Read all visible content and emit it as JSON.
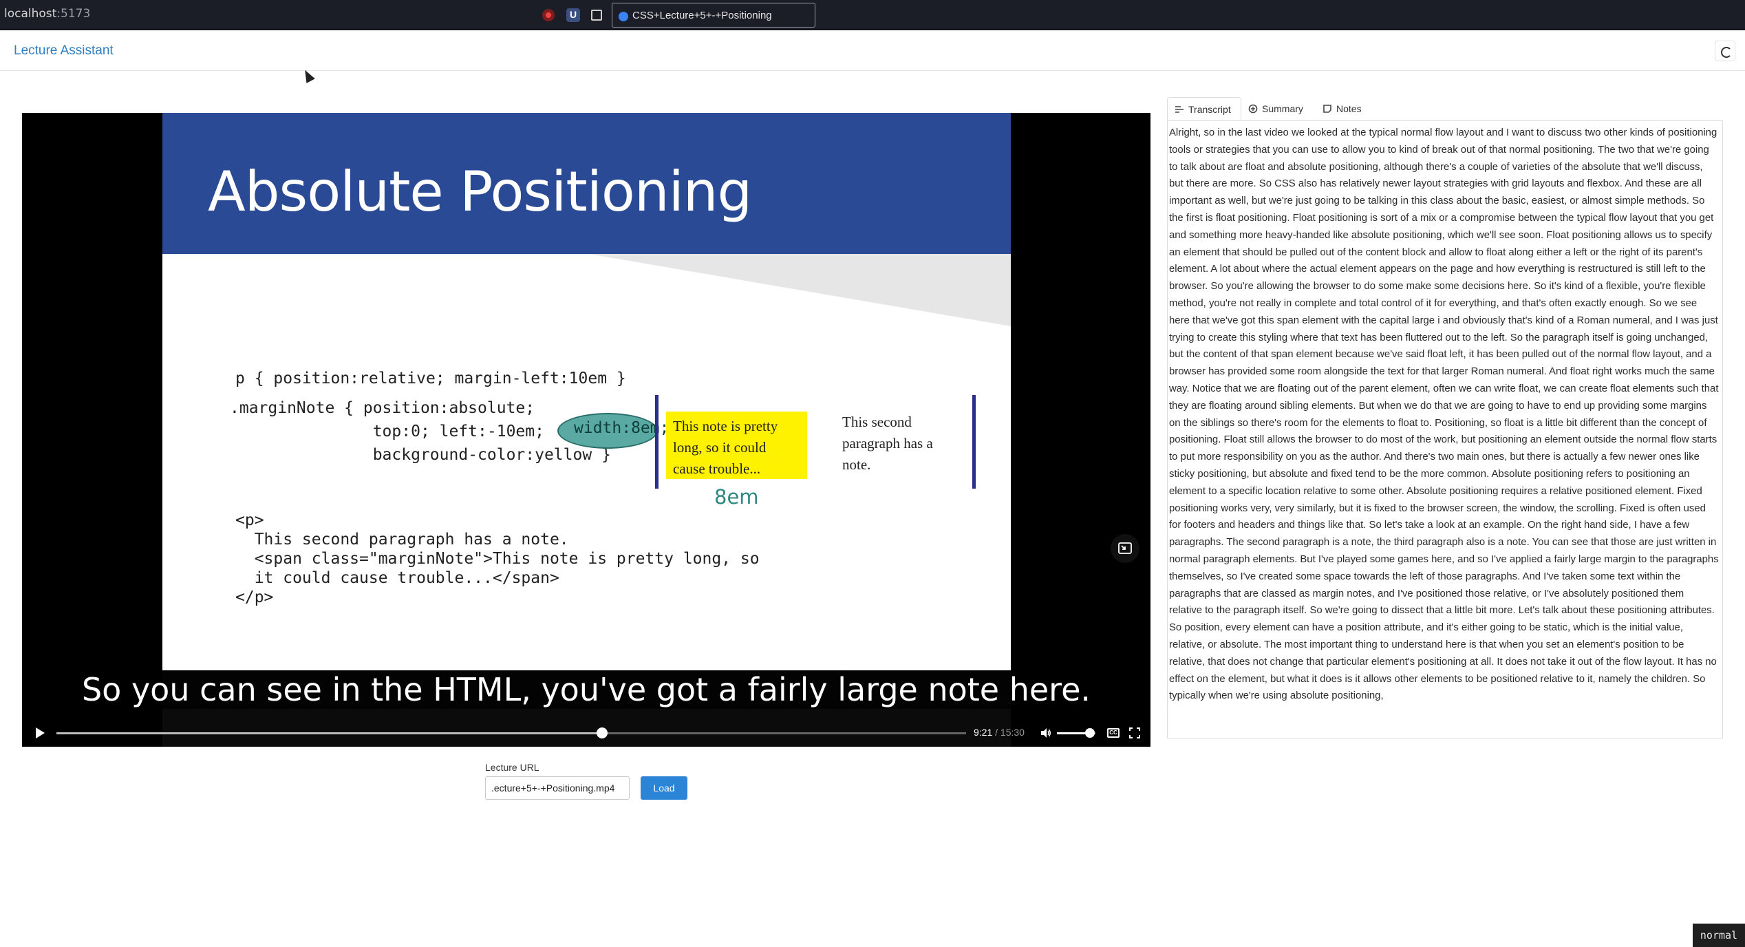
{
  "browser": {
    "host": "localhost",
    "port": ":5173",
    "tab_title": "CSS+Lecture+5+-+Positioning"
  },
  "app": {
    "title": "Lecture Assistant",
    "theme_toggle_icon": "theme-toggle-icon"
  },
  "video": {
    "slide": {
      "title": "Absolute Positioning",
      "code_line1": "p { position:relative; margin-left:10em }",
      "code_block2": ".marginNote { position:absolute;\n               top:0; left:-10em;\n               background-color:yellow }",
      "width_label": "width:8em;",
      "code_block3": "<p>\n  This second paragraph has a note.\n  <span class=\"marginNote\">This note is pretty long, so\n  it could cause trouble...</span>\n</p>",
      "note_text": "This note is pretty long, so it could cause trouble...",
      "para_text": "This second paragraph has a note.",
      "eight_em": "8em"
    },
    "caption": "So you can see in the HTML, you've got a fairly large note here.",
    "progress": 0.6,
    "volume": 0.85,
    "current_time": "9:21",
    "separator": " / ",
    "duration": "15:30"
  },
  "form": {
    "url_label": "Lecture URL",
    "url_value": ".ecture+5+-+Positioning.mp4",
    "load_label": "Load"
  },
  "panel": {
    "tabs": [
      {
        "label": "Transcript",
        "icon": "list-icon"
      },
      {
        "label": "Summary",
        "icon": "sparkle-icon"
      },
      {
        "label": "Notes",
        "icon": "note-icon"
      }
    ],
    "transcript": "Alright, so in the last video we looked at the typical normal flow layout and I want to discuss two other kinds of positioning tools or strategies that you can use to allow you to kind of break out of that normal positioning. The two that we're going to talk about are float and absolute positioning, although there's a couple of varieties of the absolute that we'll discuss, but there are more. So CSS also has relatively newer layout strategies with grid layouts and flexbox. And these are all important as well, but we're just going to be talking in this class about the basic, easiest, or almost simple methods. So the first is float positioning. Float positioning is sort of a mix or a compromise between the typical flow layout that you get and something more heavy-handed like absolute positioning, which we'll see soon. Float positioning allows us to specify an element that should be pulled out of the content block and allow to float along either a left or the right of its parent's element. A lot about where the actual element appears on the page and how everything is restructured is still left to the browser. So you're allowing the browser to do some make some decisions here. So it's kind of a flexible, you're flexible method, you're not really in complete and total control of it for everything, and that's often exactly enough. So we see here that we've got this span element with the capital large i and obviously that's kind of a Roman numeral, and I was just trying to create this styling where that text has been fluttered out to the left. So the paragraph itself is going unchanged, but the content of that span element because we've said float left, it has been pulled out of the normal flow layout, and a browser has provided some room alongside the text for that larger Roman numeral. And float right works much the same way. Notice that we are floating out of the parent element, often we can write float, we can create float elements such that they are floating around sibling elements. But when we do that we are going to have to end up providing some margins on the siblings so there's room for the elements to float to. Positioning, so float is a little bit different than the concept of positioning. Float still allows the browser to do most of the work, but positioning an element outside the normal flow starts to put more responsibility on you as the author. And there's two main ones, but there is actually a few newer ones like sticky positioning, but absolute and fixed tend to be the more common. Absolute positioning refers to positioning an element to a specific location relative to some other. Absolute positioning requires a relative positioned element. Fixed positioning works very, very similarly, but it is fixed to the browser screen, the window, the scrolling. Fixed is often used for footers and headers and things like that. So let's take a look at an example. On the right hand side, I have a few paragraphs. The second paragraph is a note, the third paragraph also is a note. You can see that those are just written in normal paragraph elements. But I've played some games here, and so I've applied a fairly large margin to the paragraphs themselves, so I've created some space towards the left of those paragraphs. And I've taken some text within the paragraphs that are classed as margin notes, and I've positioned those relative, or I've absolutely positioned them relative to the paragraph itself. So we're going to dissect that a little bit more. Let's talk about these positioning attributes. So position, every element can have a position attribute, and it's either going to be static, which is the initial value, relative, or absolute. The most important thing to understand here is that when you set an element's position to be relative, that does not change that particular element's positioning at all. It does not take it out of the flow layout. It has no effect on the element, but what it does is it allows other elements to be positioned relative to it, namely the children. So typically when we're using absolute positioning,"
  },
  "status": {
    "mode": "normal"
  }
}
